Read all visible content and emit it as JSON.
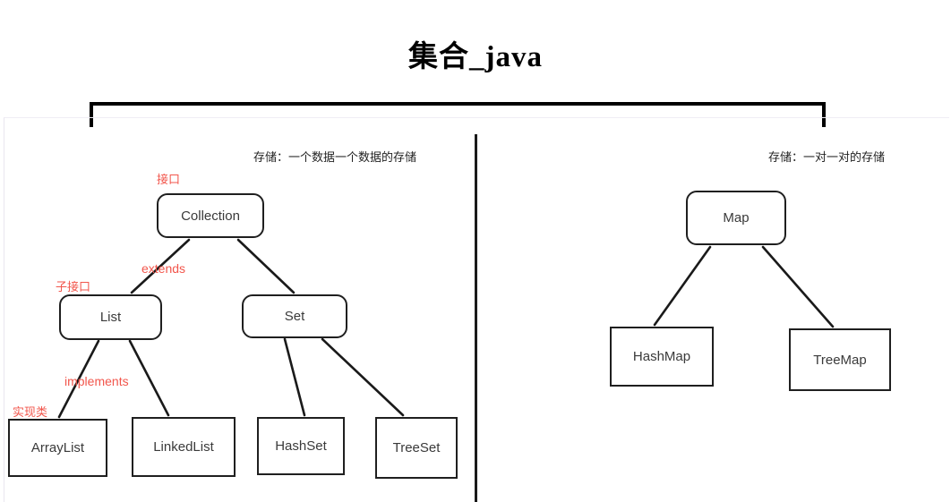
{
  "title": "集合_java",
  "captions": {
    "left": "存储：一个数据一个数据的存储",
    "right": "存储：一对一对的存储"
  },
  "colors": {
    "annotation": "#f2564c",
    "node_border": "#1f1f1f",
    "node_text": "#3a3a3a",
    "edge": "#1a1a1a",
    "background": "#ffffff"
  },
  "left_tree": {
    "root": "Collection",
    "interfaces": [
      "List",
      "Set"
    ],
    "classes": [
      "ArrayList",
      "LinkedList",
      "HashSet",
      "TreeSet"
    ],
    "nodes": {
      "collection": "Collection",
      "list": "List",
      "set": "Set",
      "arraylist": "ArrayList",
      "linkedlist": "LinkedList",
      "hashset": "HashSet",
      "treeset": "TreeSet"
    }
  },
  "right_tree": {
    "root": "Map",
    "classes": [
      "HashMap",
      "TreeMap"
    ],
    "nodes": {
      "map": "Map",
      "hashmap": "HashMap",
      "treemap": "TreeMap"
    }
  },
  "annotations": {
    "interface": "接口",
    "sub_interface": "子接口",
    "extends": "extends",
    "implements": "implements",
    "implementation_class": "实现类"
  }
}
